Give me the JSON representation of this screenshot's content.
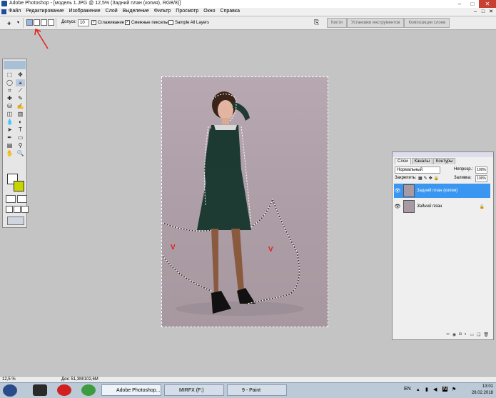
{
  "window": {
    "title": "Adobe Photoshop - [модель 1.JPG @ 12,5% (Задний план (копия), RGB/8)]",
    "controls": [
      "–",
      "□",
      "✕"
    ]
  },
  "menu": {
    "items": [
      "Файл",
      "Редактирование",
      "Изображение",
      "Слой",
      "Выделение",
      "Фильтр",
      "Просмотр",
      "Окно",
      "Справка"
    ],
    "doc_controls": [
      "–",
      "□",
      "✕"
    ]
  },
  "options_bar": {
    "tolerance_label": "Допуск:",
    "tolerance_value": "10",
    "antialias_label": "Сглаживание",
    "antialias_checked": true,
    "contiguous_label": "Смежные пикселы",
    "contiguous_checked": true,
    "sample_all_label": "Sample All Layers",
    "sample_all_checked": false,
    "palette_well": [
      "Кисти",
      "Установки инструментов",
      "Композиции слоев"
    ]
  },
  "annotations": {
    "arrow_color": "#e02020",
    "v_marks": [
      "V",
      "V"
    ]
  },
  "colors": {
    "foreground": "#ffffff",
    "background": "#c8d400",
    "selection_highlight": "#3a96f0",
    "workspace": "#c4c4c4"
  },
  "toolbox": {
    "tools": [
      "marquee-icon",
      "move-icon",
      "lasso-icon",
      "magic-wand-icon",
      "crop-icon",
      "slice-icon",
      "healing-icon",
      "brush-icon",
      "stamp-icon",
      "history-brush-icon",
      "eraser-icon",
      "gradient-icon",
      "blur-icon",
      "dodge-icon",
      "path-select-icon",
      "type-icon",
      "pen-icon",
      "shape-icon",
      "notes-icon",
      "eyedropper-icon",
      "hand-icon",
      "zoom-icon"
    ],
    "glyphs": [
      "⬚",
      "✥",
      "◯",
      "⚹",
      "⌗",
      "⟋",
      "✚",
      "✎",
      "⛁",
      "✍",
      "◫",
      "▥",
      "💧",
      "◐",
      "➤",
      "T",
      "✒",
      "▭",
      "▤",
      "⚲",
      "✋",
      "🔍"
    ],
    "selected_tool": "magic-wand-icon"
  },
  "layers_panel": {
    "tabs": [
      "Слои",
      "Каналы",
      "Контуры"
    ],
    "active_tab": "Слои",
    "blend_mode": "Нормальный",
    "opacity_label": "Непрозр.:",
    "opacity_value": "100%",
    "lock_label": "Закрепить:",
    "fill_label": "Заливка:",
    "fill_value": "100%",
    "layers": [
      {
        "name": "Задний план (копия)",
        "selected": true,
        "locked": false
      },
      {
        "name": "Задний план",
        "selected": false,
        "locked": true
      }
    ],
    "footer_icons": [
      "link-icon",
      "fx-icon",
      "mask-icon",
      "adjustment-icon",
      "group-icon",
      "new-layer-icon",
      "trash-icon"
    ]
  },
  "status_bar": {
    "zoom": "12,5 %",
    "doc_info": "Док: 51,3М/102,6М"
  },
  "taskbar": {
    "tasks": [
      {
        "label": "Adobe Photoshop...",
        "active": true
      },
      {
        "label": "MIRFX (F:)",
        "active": false
      },
      {
        "label": "9 - Paint",
        "active": false
      }
    ],
    "lang": "EN",
    "time": "13:01",
    "date": "28.02.2018"
  }
}
